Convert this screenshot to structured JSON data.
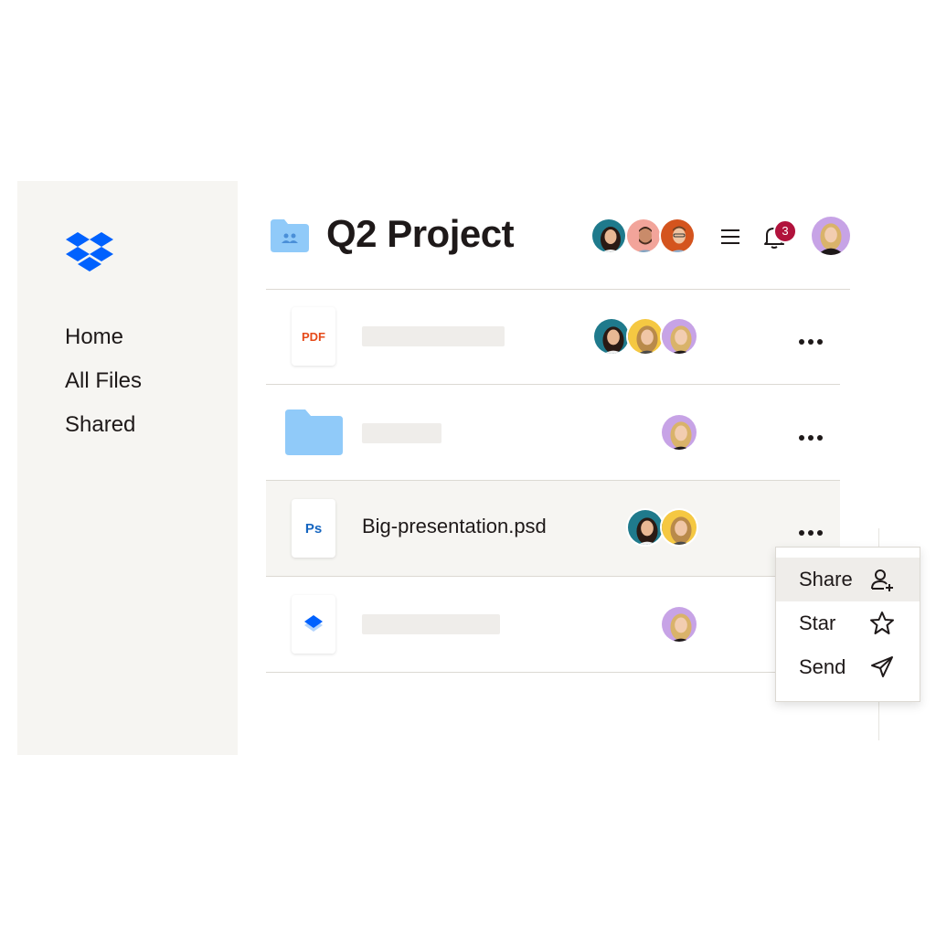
{
  "sidebar": {
    "logo": "dropbox-logo",
    "items": [
      {
        "label": "Home"
      },
      {
        "label": "All Files"
      },
      {
        "label": "Shared"
      }
    ]
  },
  "header": {
    "title": "Q2 Project",
    "folder_icon": "shared-folder-icon",
    "notification_count": "3",
    "menu_icon": "hamburger-menu-icon",
    "bell_icon": "bell-icon"
  },
  "files": [
    {
      "type_label": "PDF",
      "icon": "pdf-file-icon",
      "name": "",
      "avatars": 3
    },
    {
      "type_label": "",
      "icon": "folder-icon",
      "name": "",
      "avatars": 1
    },
    {
      "type_label": "Ps",
      "icon": "photoshop-file-icon",
      "name": "Big-presentation.psd",
      "avatars": 2
    },
    {
      "type_label": "",
      "icon": "dropbox-file-icon",
      "name": "",
      "avatars": 1
    }
  ],
  "context_menu": {
    "items": [
      {
        "label": "Share",
        "icon": "add-person-icon"
      },
      {
        "label": "Star",
        "icon": "star-icon"
      },
      {
        "label": "Send",
        "icon": "send-icon"
      }
    ]
  },
  "colors": {
    "accent": "#0061fe",
    "folder": "#90caf9",
    "sidebar_bg": "#f6f5f2",
    "badge": "#b1123c",
    "pdf_red": "#e64a19"
  }
}
